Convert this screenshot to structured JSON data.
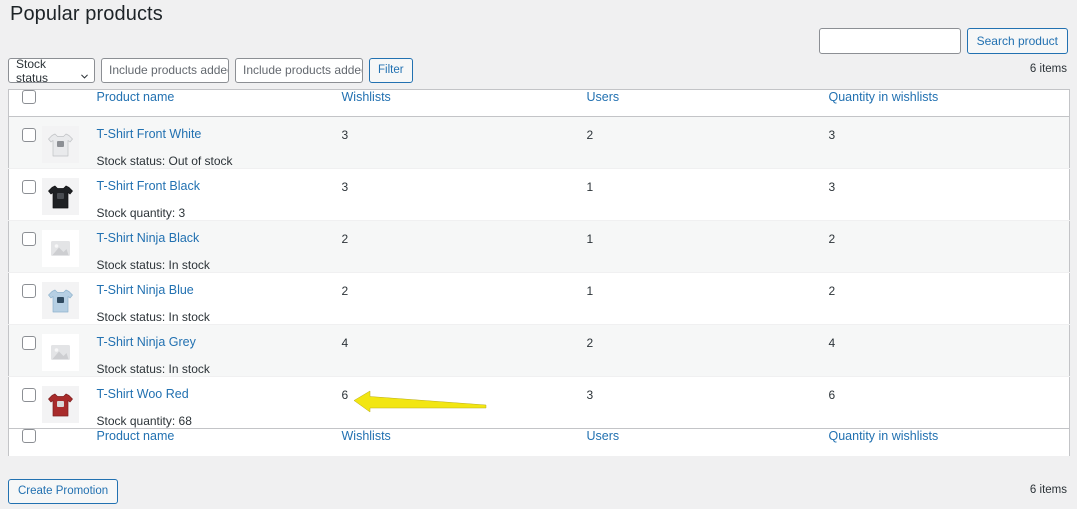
{
  "page": {
    "title": "Popular products"
  },
  "search": {
    "value": "",
    "placeholder": "",
    "button_label": "Search product"
  },
  "counts": {
    "top_items": "6 items",
    "bottom_items": "6 items"
  },
  "filters": {
    "stock_status_label": "Stock status",
    "stock_status_icon": "chevron-down-icon",
    "date_after_placeholder": "Include products added after",
    "date_after_visible": "Include products added a",
    "date_before_placeholder": "Include products added before",
    "date_before_visible": "Include products added b",
    "filter_button_label": "Filter"
  },
  "table": {
    "columns": [
      {
        "key": "name",
        "label": "Product name"
      },
      {
        "key": "wishlists",
        "label": "Wishlists"
      },
      {
        "key": "users",
        "label": "Users"
      },
      {
        "key": "quantity",
        "label": "Quantity in wishlists"
      }
    ],
    "rows": [
      {
        "name": "T-Shirt Front White",
        "stock": "Stock status: Out of stock",
        "wishlists": "3",
        "users": "2",
        "quantity": "3",
        "thumb": "tshirt-white-thumb"
      },
      {
        "name": "T-Shirt Front Black",
        "stock": "Stock quantity: 3",
        "wishlists": "3",
        "users": "1",
        "quantity": "3",
        "thumb": "tshirt-black-thumb"
      },
      {
        "name": "T-Shirt Ninja Black",
        "stock": "Stock status: In stock",
        "wishlists": "2",
        "users": "1",
        "quantity": "2",
        "thumb": "placeholder-image-thumb"
      },
      {
        "name": "T-Shirt Ninja Blue",
        "stock": "Stock status: In stock",
        "wishlists": "2",
        "users": "1",
        "quantity": "2",
        "thumb": "tshirt-blue-thumb"
      },
      {
        "name": "T-Shirt Ninja Grey",
        "stock": "Stock status: In stock",
        "wishlists": "4",
        "users": "2",
        "quantity": "4",
        "thumb": "placeholder-image-thumb"
      },
      {
        "name": "T-Shirt Woo Red",
        "stock": "Stock quantity: 68",
        "wishlists": "6",
        "users": "3",
        "quantity": "6",
        "thumb": "tshirt-red-thumb"
      }
    ]
  },
  "footer": {
    "create_promotion_label": "Create Promotion"
  },
  "annotation": {
    "type": "arrow",
    "direction": "left",
    "color": "#f2e612",
    "points_at": "wishlists-value-row-6"
  },
  "colors": {
    "accent_link": "#2271b1",
    "text": "#2c3338",
    "row_alt": "#f6f7f7",
    "page_bg": "#f0f0f1",
    "border": "#c3c4c7",
    "arrow": "#f2e612"
  }
}
